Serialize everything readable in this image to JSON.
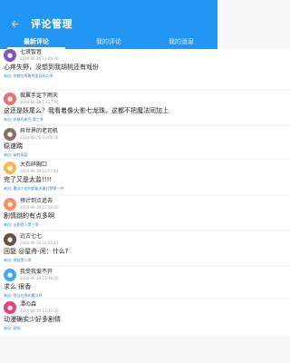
{
  "header": {
    "title": "评论管理"
  },
  "tabs": [
    {
      "label": "最新评论",
      "active": true
    },
    {
      "label": "我的评论",
      "active": false
    },
    {
      "label": "我的消息",
      "active": false
    }
  ],
  "colors": {
    "primary": "#2196f3",
    "link": "#1e88e5"
  },
  "comments": [
    {
      "user": "七贤智音",
      "time": "2024-06-26 13:44:40",
      "content": "心疼失野，没想到我胡桃还有戏份",
      "source": "来自: 你都在等着鸡里面的二季",
      "avatar_color": "#7e57c2",
      "avatar_icon": "avatar-icon"
    },
    {
      "user": "做翼手定下雨天",
      "time": "2024-06-26 13:27:00",
      "content": "这还是妖尾么？我看着像火影七龙珠。这都不把魔法同加上",
      "source": "来自: 妖精的尾巴 第三季",
      "avatar_color": "#e57373",
      "avatar_icon": "avatar-icon"
    },
    {
      "user": "异世界的老司机",
      "time": "2024-06-26 13:06:56",
      "content": "稳速踹",
      "source": "来自: 碳特高层",
      "avatar_color": "#8d6e63",
      "avatar_icon": "avatar-icon"
    },
    {
      "user": "大石碎胸口",
      "time": "2024-06-26 12:57:14",
      "content": "完了又是太监!!!!",
      "source": "来自: 魔法少女的超级夫妻打野第一件",
      "avatar_color": "#ffb74d",
      "avatar_icon": "avatar-icon"
    },
    {
      "user": "预计到点追去",
      "time": "2024-06-26 12:54:00",
      "content": "剧情跳的有点多啊",
      "source": "来自: 全职猎人第三季",
      "avatar_color": "#ff8a65",
      "avatar_icon": "avatar-icon"
    },
    {
      "user": "远古七七",
      "time": "2024-06-26 12:52:11",
      "content": "回复 @星舟-闲：什么?",
      "source": "来自: 地狱第二季",
      "avatar_color": "#6d4c41",
      "avatar_icon": "avatar-icon"
    },
    {
      "user": "我受我爱不开",
      "time": "2024-06-26 12:48:00",
      "content": "求么 很香",
      "source": "来自: 我当在我的魔法师",
      "avatar_color": "#42a5f5",
      "avatar_icon": "avatar-icon"
    },
    {
      "user": "潭の森",
      "time": "2024-06-26 12:42:20",
      "content": "动漫确实少好多剧情",
      "source": "来自: 剧场",
      "avatar_color": "#ec407a",
      "avatar_icon": "avatar-icon"
    }
  ]
}
